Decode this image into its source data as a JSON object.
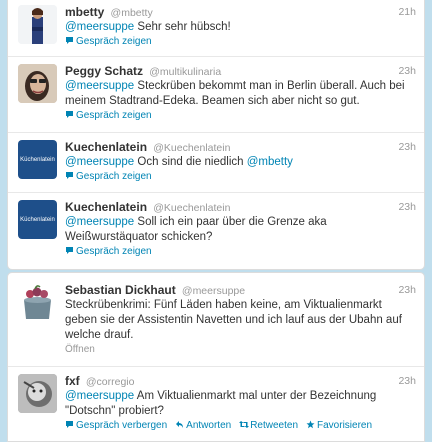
{
  "tweets_top": [
    {
      "fullname": "mbetty",
      "username": "@mbetty",
      "time": "21h",
      "mention": "@meersuppe",
      "text": " Sehr sehr hübsch!",
      "action": "Gespräch zeigen"
    },
    {
      "fullname": "Peggy Schatz",
      "username": "@multikulinaria",
      "time": "23h",
      "mention": "@meersuppe",
      "text": " Steckrüben bekommt man in Berlin überall. Auch bei meinem Stadtrand-Edeka. Beamen sich aber nicht so gut.",
      "action": "Gespräch zeigen"
    },
    {
      "fullname": "Kuechenlatein",
      "username": "@Kuechenlatein",
      "time": "23h",
      "mention": "@meersuppe",
      "text": " Och sind die niedlich ",
      "mention2": "@mbetty",
      "action": "Gespräch zeigen",
      "avatar_text": "Küchenlatein"
    },
    {
      "fullname": "Kuechenlatein",
      "username": "@Kuechenlatein",
      "time": "23h",
      "mention": "@meersuppe",
      "text": " Soll ich ein paar über die Grenze aka Weißwurstäquator schicken?",
      "action": "Gespräch zeigen",
      "avatar_text": "Küchenlatein"
    }
  ],
  "tweets_bottom": [
    {
      "fullname": "Sebastian Dickhaut",
      "username": "@meersuppe",
      "time": "23h",
      "text": "Steckrübenkrimi: Fünf Läden haben keine, am Viktualienmarkt geben sie der Assistentin Navetten und ich lauf aus der Ubahn auf welche drauf.",
      "open": "Öffnen"
    },
    {
      "fullname": "fxf",
      "username": "@corregio",
      "time": "23h",
      "mention": "@meersuppe",
      "text": " Am Viktualienmarkt mal unter der Bezeichnung \"Dotschn\" probiert?",
      "actions": {
        "hide": "Gespräch verbergen",
        "reply": "Antworten",
        "retweet": "Retweeten",
        "favorite": "Favorisieren"
      }
    }
  ],
  "colors": {
    "background": "#c0deed",
    "link": "#0084b4",
    "muted": "#999999",
    "text": "#333333"
  },
  "icons": [
    "speech-bubble-icon",
    "reply-icon",
    "retweet-icon",
    "star-icon"
  ]
}
